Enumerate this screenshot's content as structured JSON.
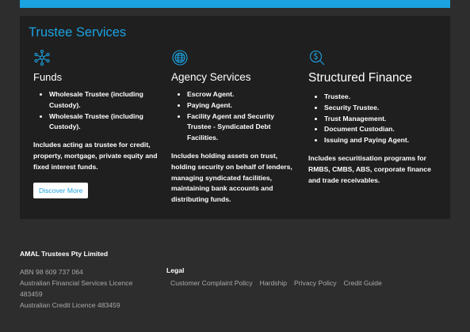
{
  "services": {
    "title": "Trustee Services",
    "accent_color": "#1ba2e0",
    "columns": [
      {
        "icon": "network-icon",
        "heading": "Funds",
        "items": [
          "Wholesale Trustee (including Custody).",
          "Wholesale Trustee (including Custody)."
        ],
        "description": "Includes acting as trustee for credit, property, mortgage, private equity and fixed interest funds.",
        "button": "Discover More"
      },
      {
        "icon": "globe-icon",
        "heading": "Agency Services",
        "items": [
          "Escrow Agent.",
          "Paying Agent.",
          "Facility Agent and Security Trustee - Syndicated Debt Facilities."
        ],
        "description": "Includes holding assets on trust, holding security on behalf of lenders, managing syndicated facilities, maintaining bank accounts and distributing funds."
      },
      {
        "icon": "dollar-search-icon",
        "heading": "Structured Finance",
        "items": [
          "Trustee.",
          "Security Trustee.",
          "Trust Management.",
          "Document Custodian.",
          "Issuing and Paying Agent."
        ],
        "description": "Includes securitisation programs for RMBS, CMBS, ABS, corporate finance and trade receivables."
      }
    ]
  },
  "footer": {
    "company": "AMAL Trustees Pty Limited",
    "abn": "ABN 98 609 737 064",
    "afsl": "Australian Financial Services Licence 483459",
    "acl": "Australian Credit Licence 483459",
    "legal_heading": "Legal",
    "links": [
      "Customer Complaint Policy",
      "Hardship",
      "Privacy Policy",
      "Credit Guide"
    ]
  }
}
